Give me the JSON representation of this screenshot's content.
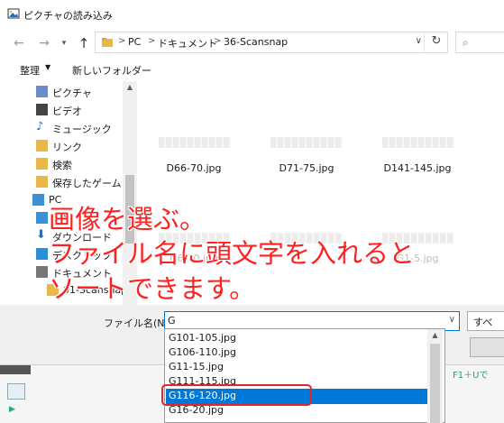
{
  "window": {
    "title": "ピクチャの読み込み"
  },
  "address": {
    "crumbs": [
      "PC",
      "ドキュメント",
      "36-Scansnap"
    ],
    "separator": ">"
  },
  "toolbar": {
    "organize_label": "整理",
    "new_folder_label": "新しいフォルダー"
  },
  "nav": {
    "items": [
      {
        "label": "ピクチャ",
        "icon": "pictures-icon",
        "color": "#6b8cc7"
      },
      {
        "label": "ビデオ",
        "icon": "video-icon",
        "color": "#444444"
      },
      {
        "label": "ミュージック",
        "icon": "music-icon",
        "color": "#2a6ebb"
      },
      {
        "label": "リンク",
        "icon": "link-folder-icon",
        "color": "#e8b84a"
      },
      {
        "label": "検索",
        "icon": "search-folder-icon",
        "color": "#e8b84a"
      },
      {
        "label": "保存したゲーム",
        "icon": "games-folder-icon",
        "color": "#e8b84a"
      },
      {
        "label": "PC",
        "icon": "pc-icon",
        "color": "#3d8fd6"
      },
      {
        "label": "3D",
        "icon": "3d-objects-icon",
        "color": "#3d8fd6"
      },
      {
        "label": "ダウンロード",
        "icon": "download-icon",
        "color": "#2a6ebb"
      },
      {
        "label": "デスクトップ",
        "icon": "desktop-icon",
        "color": "#2a8fd6"
      },
      {
        "label": "ドキュメント",
        "icon": "documents-icon",
        "color": "#777777"
      },
      {
        "label": "01-Scansnap",
        "icon": "folder-icon",
        "color": "#e8b84a"
      }
    ]
  },
  "files": [
    {
      "label": "D66-70.jpg"
    },
    {
      "label": "D71-75.jpg"
    },
    {
      "label": "D141-145.jpg"
    },
    {
      "label": "D6-10.jpg"
    },
    {
      "label": ""
    },
    {
      "label": "G1-5.jpg"
    }
  ],
  "filename": {
    "label": "ファイル名(N):",
    "value": "G"
  },
  "filter": {
    "label": "すべ"
  },
  "autocomplete": {
    "items": [
      "G101-105.jpg",
      "G106-110.jpg",
      "G11-15.jpg",
      "G111-115.jpg",
      "G116-120.jpg",
      "G16-20.jpg"
    ],
    "selected_index": 4
  },
  "background": {
    "right_text": "F1＋Uで"
  },
  "annotation": {
    "line1": "画像を選ぶ。",
    "line2": "ファイル名に頭文字を入れると",
    "line3": "ソートできます。",
    "color": "#ff2020"
  }
}
